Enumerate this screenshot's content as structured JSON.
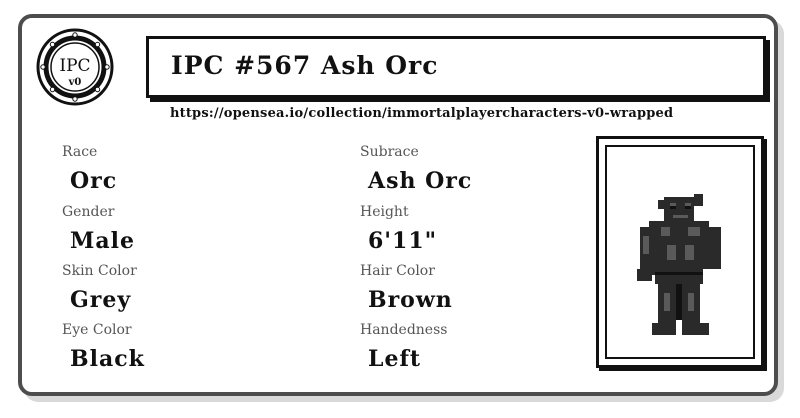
{
  "card": {
    "logo_text_top": "IPC",
    "logo_text_bottom": "v0",
    "title": "IPC #567 Ash Orc",
    "url": "https://opensea.io/collection/immortalplayercharacters-v0-wrapped"
  },
  "attributes": {
    "race_label": "Race",
    "race_value": "Orc",
    "subrace_label": "Subrace",
    "subrace_value": "Ash Orc",
    "gender_label": "Gender",
    "gender_value": "Male",
    "height_label": "Height",
    "height_value": "6'11\"",
    "skin_label": "Skin Color",
    "skin_value": "Grey",
    "hair_label": "Hair Color",
    "hair_value": "Brown",
    "eye_label": "Eye Color",
    "eye_value": "Black",
    "hand_label": "Handedness",
    "hand_value": "Left"
  },
  "colors": {
    "border": "#4d4d4d",
    "ink": "#111111",
    "label": "#555555",
    "orc_skin": "#3a3a3a"
  },
  "icons": {
    "logo": "ipc-seal-icon",
    "portrait": "orc-character-sprite"
  }
}
